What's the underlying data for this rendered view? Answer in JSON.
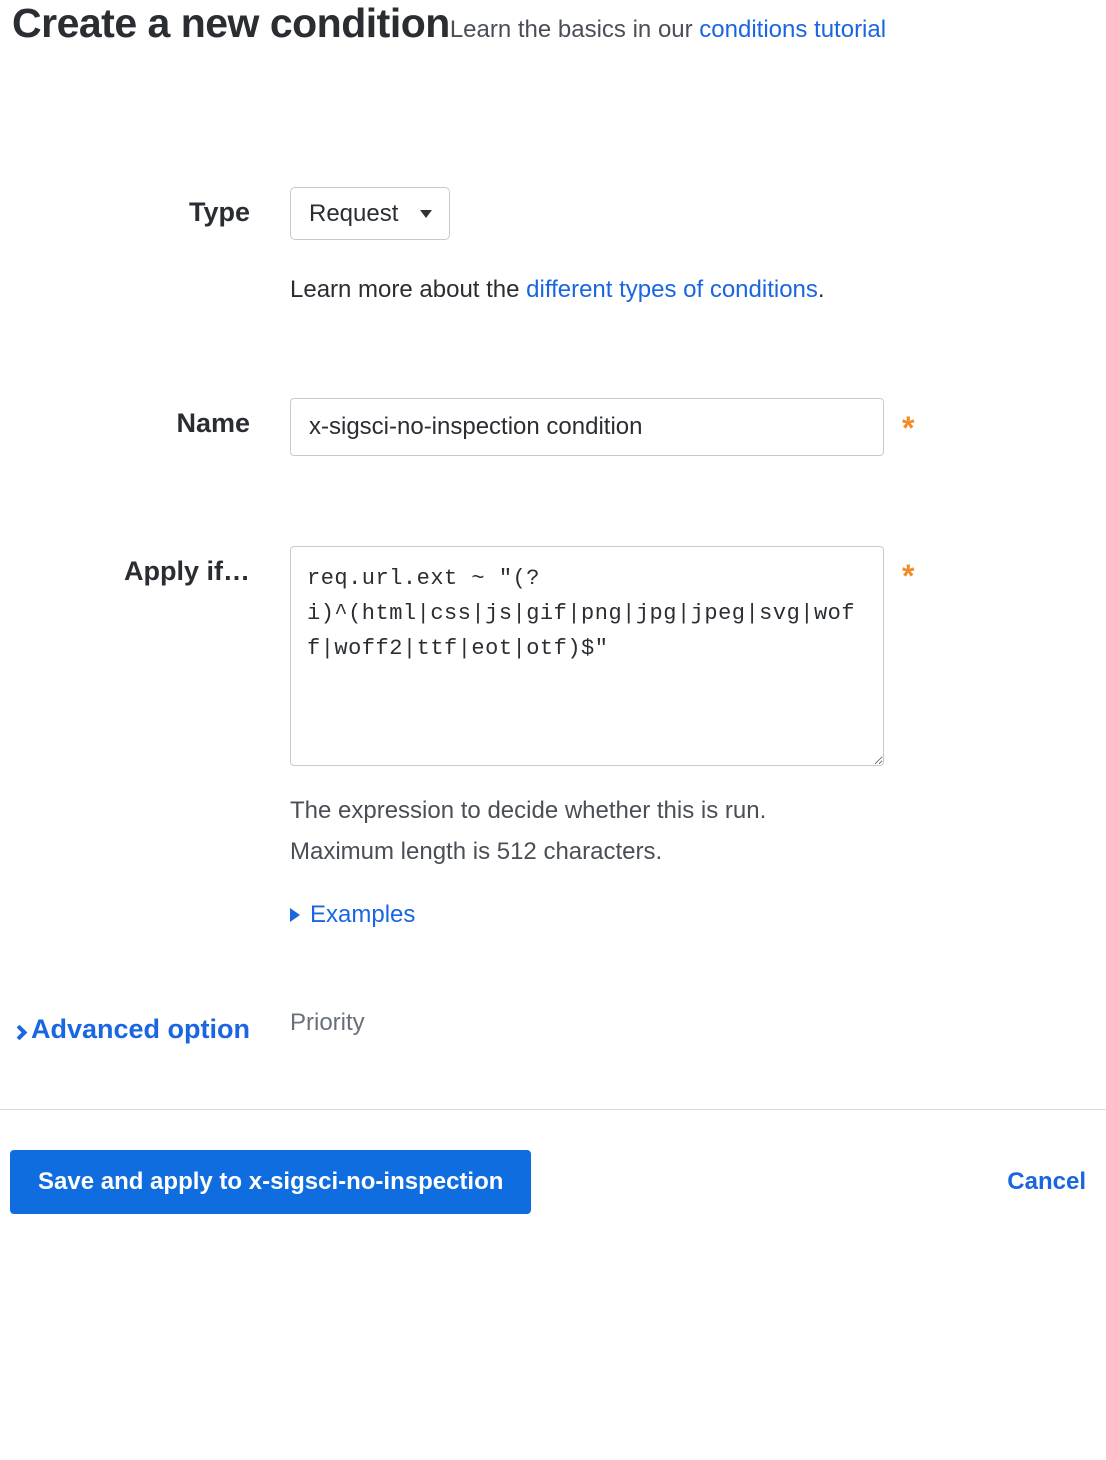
{
  "header": {
    "title": "Create a new condition",
    "subtitle_prefix": "Learn the basics in our ",
    "tutorial_link": "conditions tutorial"
  },
  "form": {
    "type": {
      "label": "Type",
      "value": "Request",
      "helper_prefix": "Learn more about the ",
      "helper_link": "different types of conditions",
      "helper_suffix": "."
    },
    "name": {
      "label": "Name",
      "value": "x-sigsci-no-inspection condition",
      "required_mark": "*"
    },
    "apply_if": {
      "label": "Apply if…",
      "value": "req.url.ext ~ \"(?i)^(html|css|js|gif|png|jpg|jpeg|svg|woff|woff2|ttf|eot|otf)$\"",
      "required_mark": "*",
      "helper_line1": "The expression to decide whether this is run.",
      "helper_line2": "Maximum length is 512 characters.",
      "examples_label": "Examples"
    },
    "advanced": {
      "label": "Advanced option",
      "value": "Priority"
    }
  },
  "footer": {
    "save_label": "Save and apply to x-sigsci-no-inspection",
    "cancel_label": "Cancel"
  }
}
